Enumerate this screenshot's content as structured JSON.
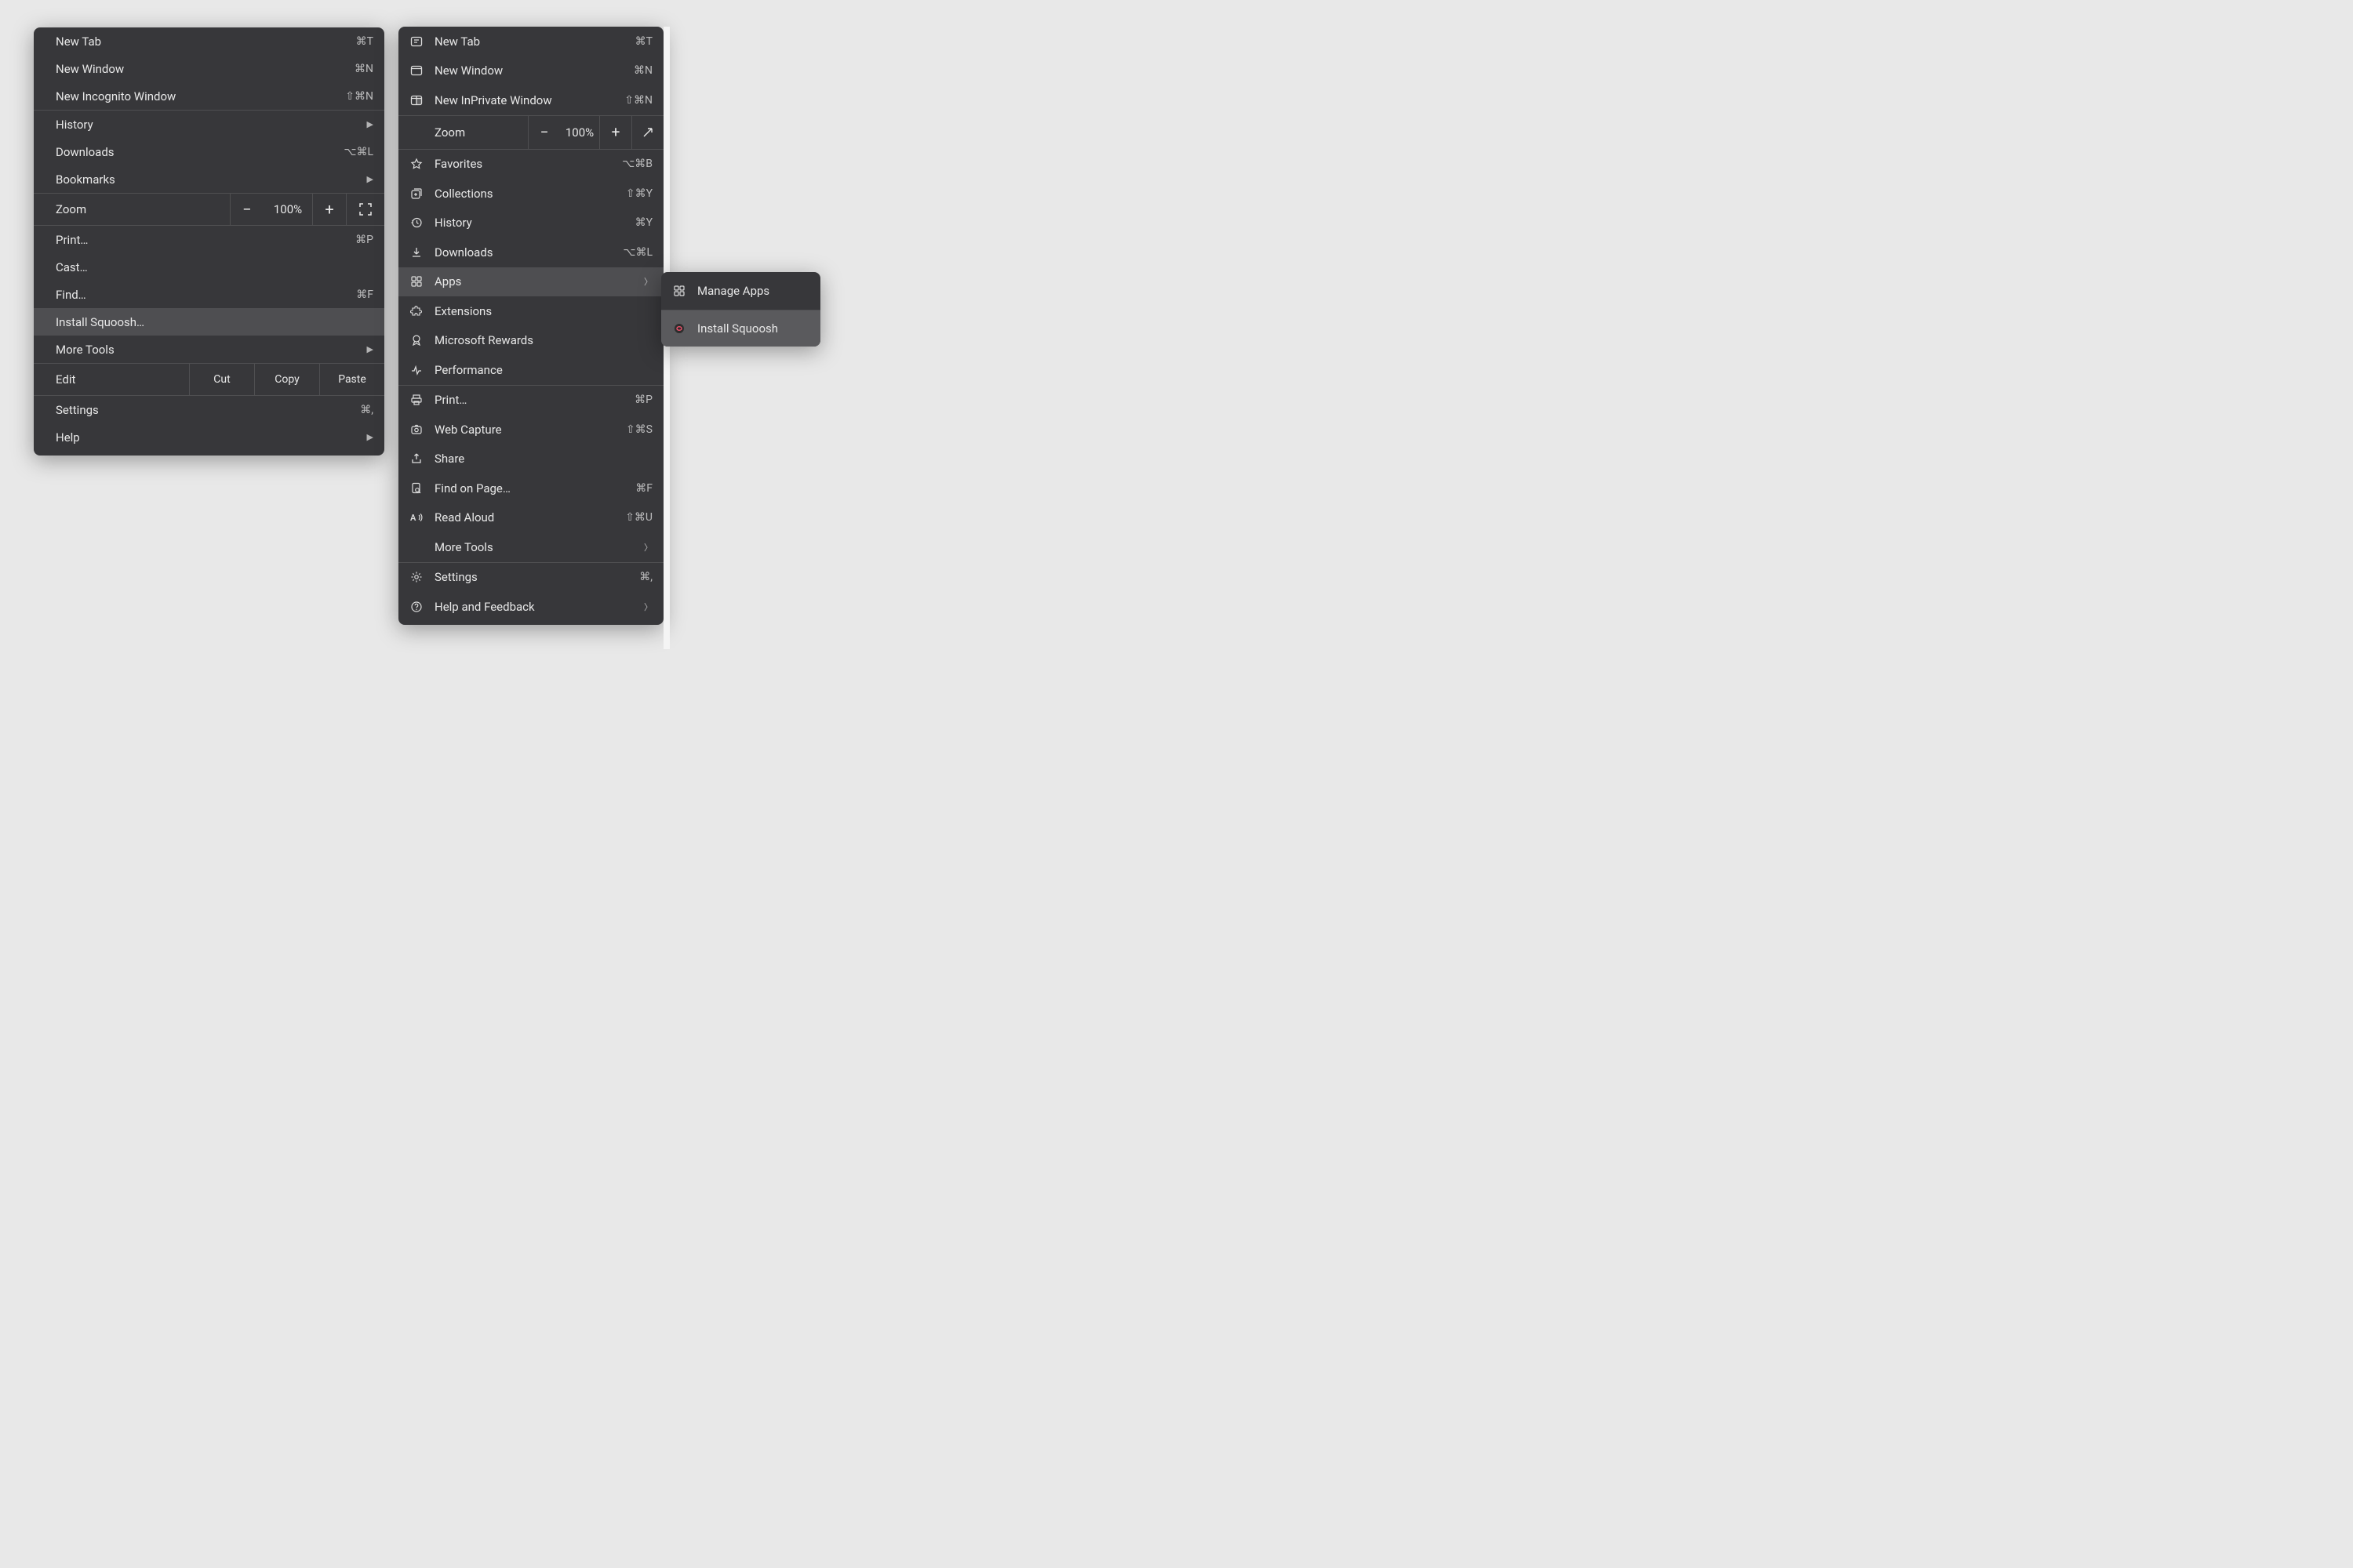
{
  "chrome": {
    "items": {
      "new_tab": {
        "label": "New Tab",
        "sc": "⌘T"
      },
      "new_window": {
        "label": "New Window",
        "sc": "⌘N"
      },
      "new_incognito": {
        "label": "New Incognito Window",
        "sc": "⇧⌘N"
      },
      "history": {
        "label": "History"
      },
      "downloads": {
        "label": "Downloads",
        "sc": "⌥⌘L"
      },
      "bookmarks": {
        "label": "Bookmarks"
      },
      "zoom": {
        "label": "Zoom",
        "value": "100%"
      },
      "print": {
        "label": "Print…",
        "sc": "⌘P"
      },
      "cast": {
        "label": "Cast…"
      },
      "find": {
        "label": "Find…",
        "sc": "⌘F"
      },
      "install": {
        "label": "Install Squoosh…"
      },
      "more_tools": {
        "label": "More Tools"
      },
      "edit": {
        "label": "Edit",
        "cut": "Cut",
        "copy": "Copy",
        "paste": "Paste"
      },
      "settings": {
        "label": "Settings",
        "sc": "⌘,"
      },
      "help": {
        "label": "Help"
      }
    }
  },
  "edge": {
    "items": {
      "new_tab": {
        "label": "New Tab",
        "sc": "⌘T"
      },
      "new_window": {
        "label": "New Window",
        "sc": "⌘N"
      },
      "new_inprivate": {
        "label": "New InPrivate Window",
        "sc": "⇧⌘N"
      },
      "zoom": {
        "label": "Zoom",
        "value": "100%"
      },
      "favorites": {
        "label": "Favorites",
        "sc": "⌥⌘B"
      },
      "collections": {
        "label": "Collections",
        "sc": "⇧⌘Y"
      },
      "history": {
        "label": "History",
        "sc": "⌘Y"
      },
      "downloads": {
        "label": "Downloads",
        "sc": "⌥⌘L"
      },
      "apps": {
        "label": "Apps"
      },
      "extensions": {
        "label": "Extensions"
      },
      "rewards": {
        "label": "Microsoft Rewards"
      },
      "performance": {
        "label": "Performance"
      },
      "print": {
        "label": "Print…",
        "sc": "⌘P"
      },
      "web_capture": {
        "label": "Web Capture",
        "sc": "⇧⌘S"
      },
      "share": {
        "label": "Share"
      },
      "find": {
        "label": "Find on Page…",
        "sc": "⌘F"
      },
      "read_aloud": {
        "label": "Read Aloud",
        "sc": "⇧⌘U"
      },
      "more_tools": {
        "label": "More Tools"
      },
      "settings": {
        "label": "Settings",
        "sc": "⌘,"
      },
      "help": {
        "label": "Help and Feedback"
      }
    }
  },
  "submenu": {
    "manage": {
      "label": "Manage Apps"
    },
    "install": {
      "label": "Install Squoosh"
    }
  }
}
